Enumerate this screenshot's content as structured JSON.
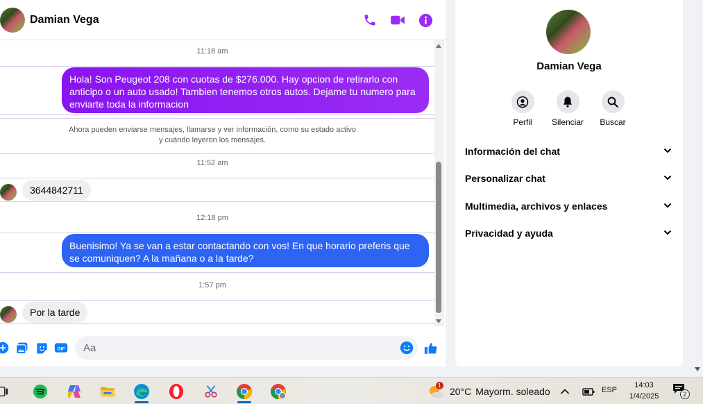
{
  "chat": {
    "contact_name": "Damian Vega",
    "timestamps": [
      "11:18 am",
      "11:52 am",
      "12:18 pm",
      "1:57 pm"
    ],
    "messages": [
      {
        "direction": "outgoing",
        "text": "Hola! Son Peugeot 208 con cuotas de $276.000. Hay opcion de retirarlo con anticipo o un auto usado! Tambien tenemos otros autos. Dejame tu numero para enviarte toda la informacion"
      },
      {
        "direction": "incoming",
        "text": "3644842711"
      },
      {
        "direction": "outgoing",
        "text": "Buenisimo! Ya se van a estar contactando con vos! En que horario preferis que se comuniquen? A la mañana o a la tarde?"
      },
      {
        "direction": "incoming",
        "text": "Por la tarde"
      }
    ],
    "notice_line1": "Ahora pueden enviarse mensajes, llamarse y ver información, como su estado activo",
    "notice_line2": "y cuándo leyeron los mensajes.",
    "composer_placeholder": "Aa",
    "gif_label": "GIF"
  },
  "info_panel": {
    "name": "Damian Vega",
    "actions": [
      "Perfil",
      "Silenciar",
      "Buscar"
    ],
    "sections": [
      "Información del chat",
      "Personalizar chat",
      "Multimedia, archivos y enlaces",
      "Privacidad y ayuda"
    ]
  },
  "taskbar": {
    "weather_temp": "20°C",
    "weather_desc": "Mayorm. soleado",
    "weather_badge": "1",
    "language": "ESP",
    "time": "14:03",
    "date": "1/4/2025",
    "notification_count": "2"
  },
  "colors": {
    "messenger_accent": "#9b2cf5",
    "outgoing_purple": "#8a14f0",
    "outgoing_blue": "#2d64f4",
    "composer_blue": "#0a7cff"
  }
}
